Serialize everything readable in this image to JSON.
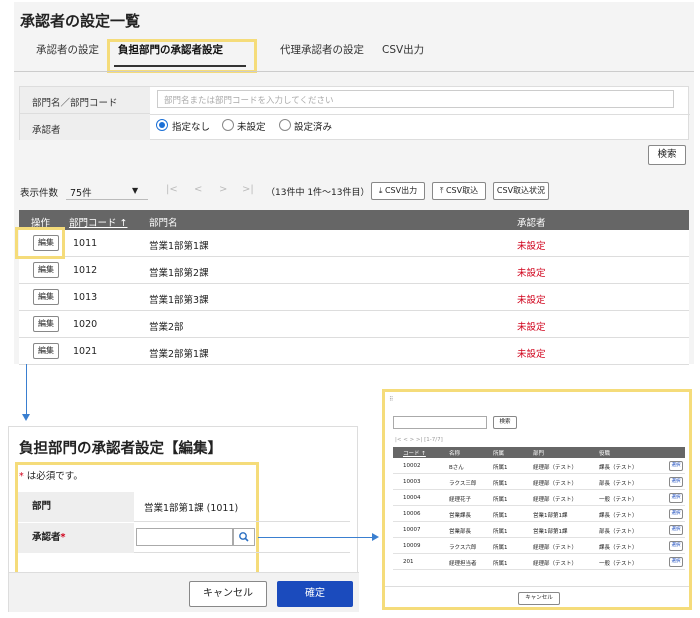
{
  "page_title": "承認者の設定一覧",
  "tabs": [
    "承認者の設定",
    "負担部門の承認者設定",
    "代理承認者の設定",
    "CSV出力"
  ],
  "filter": {
    "dept_label": "部門名／部門コード",
    "dept_placeholder": "部門名または部門コードを入力してください",
    "approver_label": "承認者",
    "radios": [
      "指定なし",
      "未設定",
      "設定済み"
    ],
    "search_button": "検索"
  },
  "pager": {
    "count_label": "表示件数",
    "count_value": "75件",
    "first": "|<",
    "prev": "<",
    "next": ">",
    "last": ">|",
    "info": "（13件中 1件～13件目）",
    "csv_out": "CSV出力",
    "csv_in": "CSV取込",
    "csv_status": "CSV取込状況"
  },
  "table": {
    "headers": [
      "操作",
      "部門コード ↑",
      "部門名",
      "承認者"
    ],
    "edit_label": "編集",
    "rows": [
      {
        "code": "1011",
        "name": "営業1部第1課",
        "status": "未設定"
      },
      {
        "code": "1012",
        "name": "営業1部第2課",
        "status": "未設定"
      },
      {
        "code": "1013",
        "name": "営業1部第3課",
        "status": "未設定"
      },
      {
        "code": "1020",
        "name": "営業2部",
        "status": "未設定"
      },
      {
        "code": "1021",
        "name": "営業2部第1課",
        "status": "未設定"
      }
    ]
  },
  "edit_dialog": {
    "title": "負担部門の承認者設定【編集】",
    "required_star": "*",
    "required_note": "は必須です。",
    "dept_label": "部門",
    "dept_value": "営業1部第1課 (1011)",
    "approver_label": "承認者",
    "cancel": "キャンセル",
    "ok": "確定"
  },
  "popup": {
    "search_button": "検索",
    "pager": "|< < > >| [1-7/7]",
    "headers": [
      "コード ↑",
      "名称",
      "所属",
      "部門",
      "役職"
    ],
    "select_label": "選択",
    "cancel": "キャンセル",
    "rows": [
      {
        "code": "10002",
        "name": "Bさん",
        "affil": "所属1",
        "dept": "経理部（テスト）",
        "role": "課長（テスト）"
      },
      {
        "code": "10003",
        "name": "ラクス三郎",
        "affil": "所属1",
        "dept": "経理部（テスト）",
        "role": "部長（テスト）"
      },
      {
        "code": "10004",
        "name": "経理花子",
        "affil": "所属1",
        "dept": "経理部（テスト）",
        "role": "一般（テスト）"
      },
      {
        "code": "10006",
        "name": "営業課長",
        "affil": "所属1",
        "dept": "営業1部第1課",
        "role": "課長（テスト）"
      },
      {
        "code": "10007",
        "name": "営業部長",
        "affil": "所属1",
        "dept": "営業1部第1課",
        "role": "部長（テスト）"
      },
      {
        "code": "10009",
        "name": "ラクス六郎",
        "affil": "所属1",
        "dept": "経理部（テスト）",
        "role": "課長（テスト）"
      },
      {
        "code": "201",
        "name": "経理担当者",
        "affil": "所属1",
        "dept": "経理部（テスト）",
        "role": "一般（テスト）"
      }
    ]
  },
  "colors": {
    "accent": "#1a6fd6",
    "highlight": "#f5dc7a",
    "status": "#d0021b",
    "primary_button": "#1b4bbd",
    "header": "#666666"
  }
}
